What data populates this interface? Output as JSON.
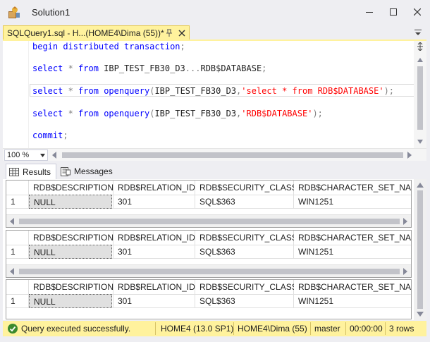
{
  "window": {
    "title": "Solution1"
  },
  "doc_tab": {
    "label": "SQLQuery1.sql - H...(HOME4\\Dima (55))*"
  },
  "editor": {
    "lines": [
      [
        {
          "t": "begin distributed transaction",
          "c": "kw"
        },
        {
          "t": ";",
          "c": "op"
        }
      ],
      [
        {
          "t": "select",
          "c": "kw"
        },
        {
          "t": " * ",
          "c": "op"
        },
        {
          "t": "from",
          "c": "kw"
        },
        {
          "t": " IBP_TEST_FB30_D3",
          "c": "id"
        },
        {
          "t": "...",
          "c": "op"
        },
        {
          "t": "RDB$DATABASE",
          "c": "id"
        },
        {
          "t": ";",
          "c": "op"
        }
      ],
      [
        {
          "t": "select",
          "c": "kw"
        },
        {
          "t": " * ",
          "c": "op"
        },
        {
          "t": "from",
          "c": "kw"
        },
        {
          "t": " ",
          "c": "id"
        },
        {
          "t": "openquery",
          "c": "kw"
        },
        {
          "t": "(",
          "c": "op"
        },
        {
          "t": "IBP_TEST_FB30_D3",
          "c": "id"
        },
        {
          "t": ",",
          "c": "op"
        },
        {
          "t": "'select * from RDB$DATABASE'",
          "c": "str"
        },
        {
          "t": ");",
          "c": "op"
        }
      ],
      [
        {
          "t": "select",
          "c": "kw"
        },
        {
          "t": " * ",
          "c": "op"
        },
        {
          "t": "from",
          "c": "kw"
        },
        {
          "t": " ",
          "c": "id"
        },
        {
          "t": "openquery",
          "c": "kw"
        },
        {
          "t": "(",
          "c": "op"
        },
        {
          "t": "IBP_TEST_FB30_D3",
          "c": "id"
        },
        {
          "t": ",",
          "c": "op"
        },
        {
          "t": "'RDB$DATABASE'",
          "c": "str"
        },
        {
          "t": ");",
          "c": "op"
        }
      ],
      [
        {
          "t": "commit",
          "c": "kw"
        },
        {
          "t": ";",
          "c": "op"
        }
      ]
    ]
  },
  "zoom": {
    "value": "100 %"
  },
  "results_tabs": {
    "results_label": "Results",
    "messages_label": "Messages"
  },
  "grids": [
    {
      "columns": [
        "RDB$DESCRIPTION",
        "RDB$RELATION_ID",
        "RDB$SECURITY_CLASS",
        "RDB$CHARACTER_SET_NAME"
      ],
      "rows": [
        {
          "num": "1",
          "cells": [
            "NULL",
            "301",
            "SQL$363",
            "WIN1251"
          ]
        }
      ]
    },
    {
      "columns": [
        "RDB$DESCRIPTION",
        "RDB$RELATION_ID",
        "RDB$SECURITY_CLASS",
        "RDB$CHARACTER_SET_NAME"
      ],
      "rows": [
        {
          "num": "1",
          "cells": [
            "NULL",
            "301",
            "SQL$363",
            "WIN1251"
          ]
        }
      ]
    },
    {
      "columns": [
        "RDB$DESCRIPTION",
        "RDB$RELATION_ID",
        "RDB$SECURITY_CLASS",
        "RDB$CHARACTER_SET_NAME"
      ],
      "rows": [
        {
          "num": "1",
          "cells": [
            "NULL",
            "301",
            "SQL$363",
            "WIN1251"
          ]
        }
      ]
    }
  ],
  "status": {
    "message": "Query executed successfully.",
    "server": "HOME4 (13.0 SP1)",
    "user": "HOME4\\Dima (55)",
    "database": "master",
    "elapsed": "00:00:00",
    "rows": "3 rows"
  },
  "icons": {
    "app": "ssms-app-icon",
    "pin": "pin-icon",
    "close": "close-icon",
    "status": "success-check-icon",
    "results": "grid-icon",
    "messages": "messages-icon"
  },
  "colors": {
    "tab_active": "#fff29d",
    "status_bar": "#fff29d",
    "keyword": "#0000ff",
    "string": "#ff0000",
    "operator": "#808080",
    "success": "#3c8a2e"
  }
}
